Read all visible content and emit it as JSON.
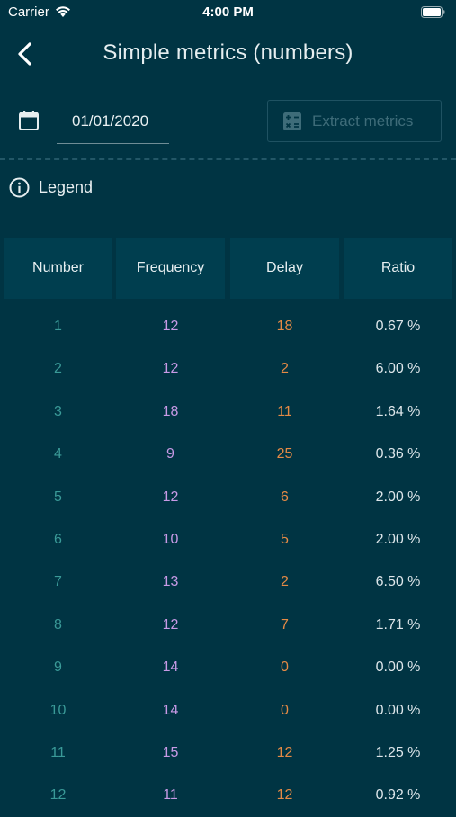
{
  "status_bar": {
    "carrier": "Carrier",
    "time": "4:00 PM"
  },
  "header": {
    "title": "Simple metrics (numbers)",
    "back_icon": "chevron-left-icon"
  },
  "date_filter": {
    "value": "01/01/2020",
    "icon": "calendar-icon"
  },
  "extract_button": {
    "label": "Extract metrics",
    "icon": "calculator-icon"
  },
  "legend": {
    "label": "Legend",
    "icon": "info-icon"
  },
  "table": {
    "columns": [
      "Number",
      "Frequency",
      "Delay",
      "Ratio"
    ],
    "rows": [
      {
        "number": "1",
        "frequency": "12",
        "delay": "18",
        "ratio": "0.67 %"
      },
      {
        "number": "2",
        "frequency": "12",
        "delay": "2",
        "ratio": "6.00 %"
      },
      {
        "number": "3",
        "frequency": "18",
        "delay": "11",
        "ratio": "1.64 %"
      },
      {
        "number": "4",
        "frequency": "9",
        "delay": "25",
        "ratio": "0.36 %"
      },
      {
        "number": "5",
        "frequency": "12",
        "delay": "6",
        "ratio": "2.00 %"
      },
      {
        "number": "6",
        "frequency": "10",
        "delay": "5",
        "ratio": "2.00 %"
      },
      {
        "number": "7",
        "frequency": "13",
        "delay": "2",
        "ratio": "6.50 %"
      },
      {
        "number": "8",
        "frequency": "12",
        "delay": "7",
        "ratio": "1.71 %"
      },
      {
        "number": "9",
        "frequency": "14",
        "delay": "0",
        "ratio": "0.00 %"
      },
      {
        "number": "10",
        "frequency": "14",
        "delay": "0",
        "ratio": "0.00 %"
      },
      {
        "number": "11",
        "frequency": "15",
        "delay": "12",
        "ratio": "1.25 %"
      },
      {
        "number": "12",
        "frequency": "11",
        "delay": "12",
        "ratio": "0.92 %"
      }
    ]
  },
  "colors": {
    "background": "#003443",
    "header_cell": "#003e4f",
    "number": "#3a9a98",
    "frequency": "#c89ae6",
    "delay": "#e58a45",
    "ratio": "#dde6ea"
  }
}
